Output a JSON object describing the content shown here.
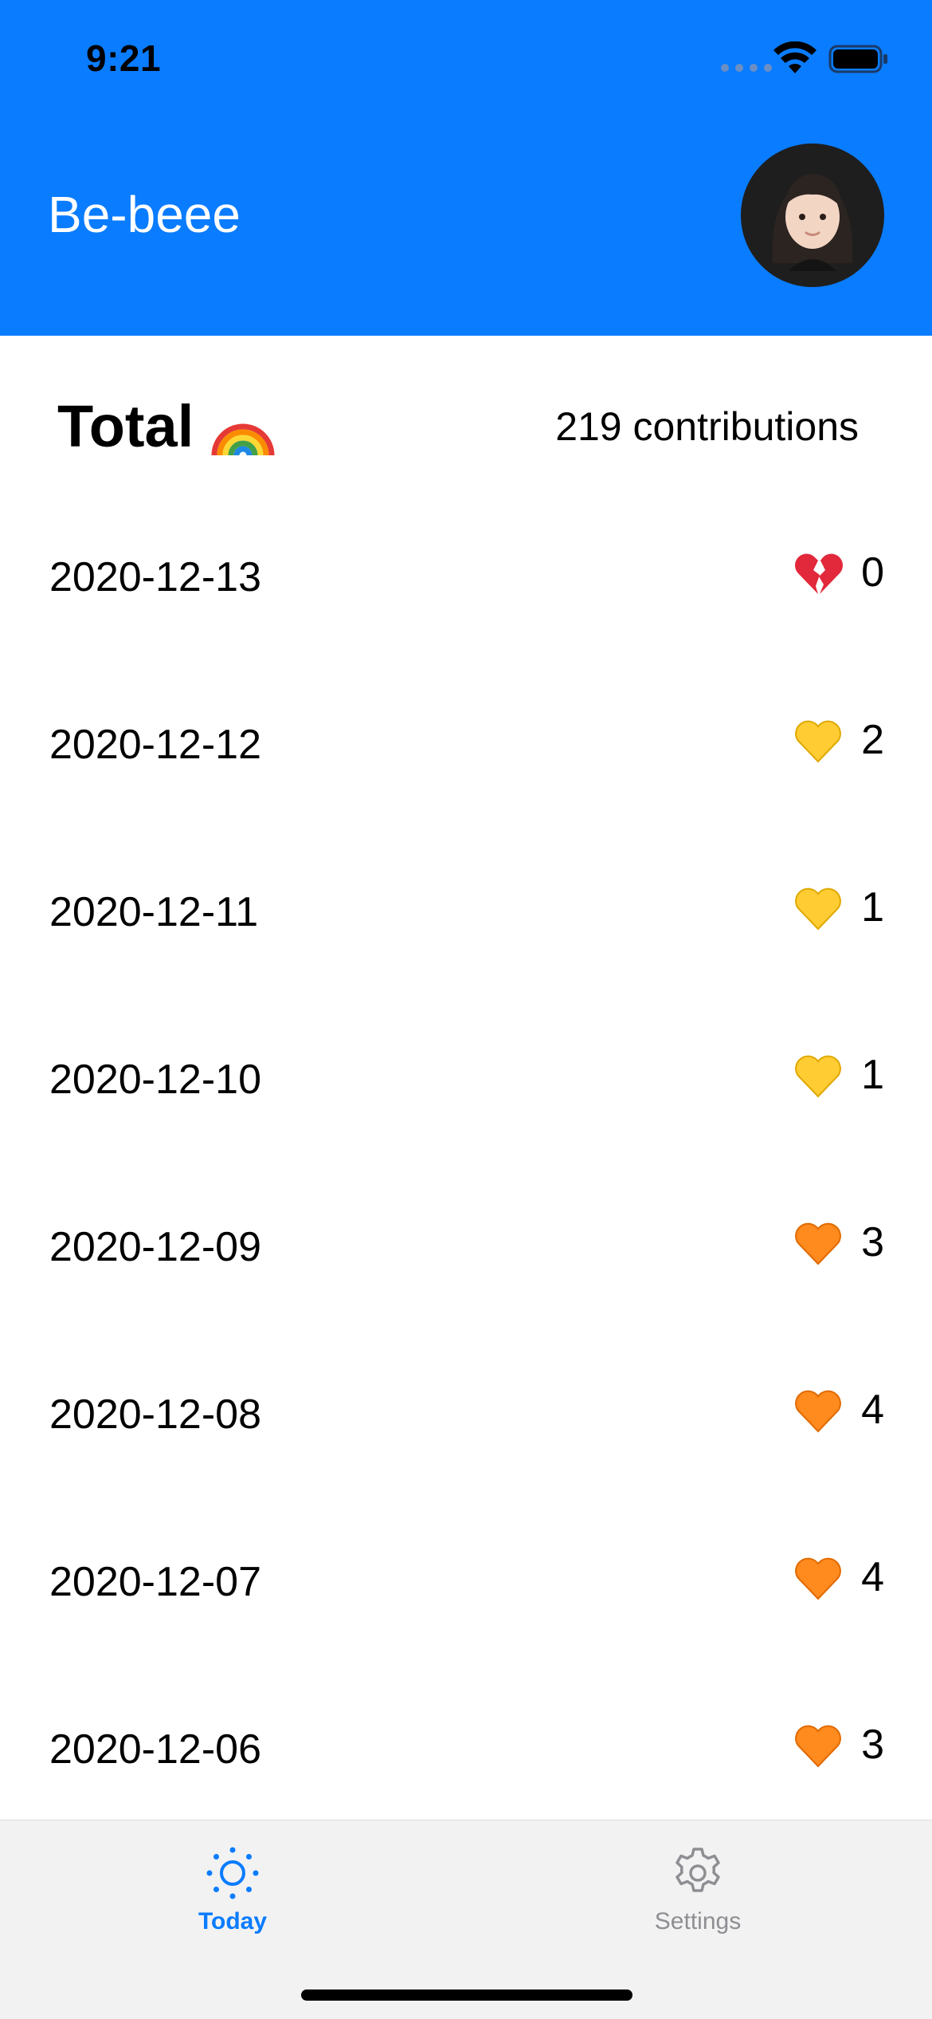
{
  "status_bar": {
    "time": "9:21"
  },
  "header": {
    "title": "Be-beee"
  },
  "total": {
    "label": "Total",
    "icon": "rainbow-icon",
    "count_text": "219 contributions"
  },
  "entries": [
    {
      "date": "2020-12-13",
      "count": "0",
      "icon": "broken-heart-icon"
    },
    {
      "date": "2020-12-12",
      "count": "2",
      "icon": "yellow-heart-icon"
    },
    {
      "date": "2020-12-11",
      "count": "1",
      "icon": "yellow-heart-icon"
    },
    {
      "date": "2020-12-10",
      "count": "1",
      "icon": "yellow-heart-icon"
    },
    {
      "date": "2020-12-09",
      "count": "3",
      "icon": "orange-heart-icon"
    },
    {
      "date": "2020-12-08",
      "count": "4",
      "icon": "orange-heart-icon"
    },
    {
      "date": "2020-12-07",
      "count": "4",
      "icon": "orange-heart-icon"
    },
    {
      "date": "2020-12-06",
      "count": "3",
      "icon": "orange-heart-icon"
    }
  ],
  "tabs": [
    {
      "label": "Today",
      "icon": "sun-icon",
      "selected": true
    },
    {
      "label": "Settings",
      "icon": "gear-icon",
      "selected": false
    }
  ],
  "colors": {
    "accent": "#0a7cff",
    "broken_heart": "#e2283b",
    "yellow_heart": "#ffcc33",
    "orange_heart": "#ff8a1e",
    "tab_inactive": "#8e8e93"
  }
}
